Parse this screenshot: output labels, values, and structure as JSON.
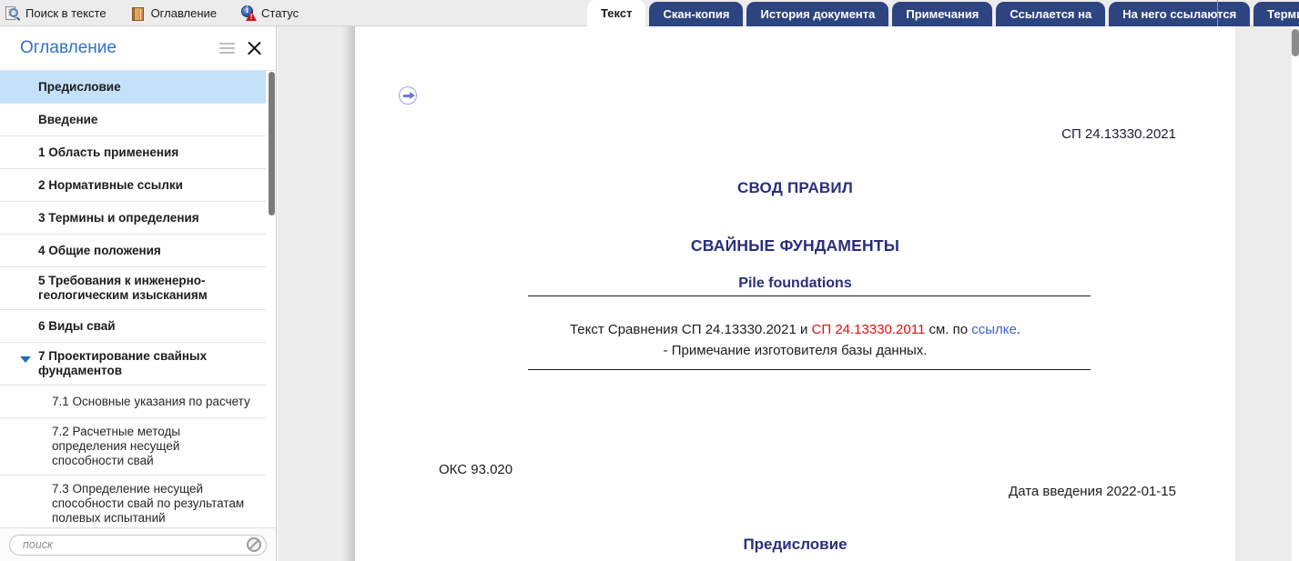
{
  "toolbar": {
    "items": [
      {
        "label": "Поиск в тексте",
        "icon": "search-document-icon"
      },
      {
        "label": "Оглавление",
        "icon": "book-icon"
      },
      {
        "label": "Статус",
        "icon": "status-info-warning-icon"
      }
    ]
  },
  "tabs": [
    {
      "label": "Текст",
      "active": true
    },
    {
      "label": "Скан-копия",
      "active": false
    },
    {
      "label": "История документа",
      "active": false
    },
    {
      "label": "Примечания",
      "active": false
    },
    {
      "label": "Ссылается на",
      "active": false
    },
    {
      "label": "На него ссылаются",
      "active": false
    },
    {
      "label": "Термины",
      "active": false
    }
  ],
  "sidebar": {
    "title": "Оглавление",
    "menu_icon": "hamburger-icon",
    "close_icon": "close-icon",
    "items": [
      {
        "label": "Предисловие",
        "level": 1,
        "selected": true,
        "expandable": false
      },
      {
        "label": "Введение",
        "level": 1,
        "selected": false,
        "expandable": false
      },
      {
        "label": "1 Область применения",
        "level": 1,
        "selected": false,
        "expandable": false
      },
      {
        "label": "2 Нормативные ссылки",
        "level": 1,
        "selected": false,
        "expandable": false
      },
      {
        "label": "3 Термины и определения",
        "level": 1,
        "selected": false,
        "expandable": false
      },
      {
        "label": "4 Общие положения",
        "level": 1,
        "selected": false,
        "expandable": false
      },
      {
        "label": "5 Требования к инженерно-геологическим изысканиям",
        "level": 1,
        "selected": false,
        "expandable": false
      },
      {
        "label": "6 Виды свай",
        "level": 1,
        "selected": false,
        "expandable": false
      },
      {
        "label": "7 Проектирование свайных фундаментов",
        "level": 1,
        "selected": false,
        "expandable": true
      },
      {
        "label": "7.1 Основные указания по расчету",
        "level": 2,
        "selected": false,
        "expandable": false
      },
      {
        "label": "7.2 Расчетные методы определения несущей способности свай",
        "level": 2,
        "selected": false,
        "expandable": false
      },
      {
        "label": "7.3 Определение несущей способности свай по результатам полевых испытаний",
        "level": 2,
        "selected": false,
        "expandable": false
      }
    ],
    "search": {
      "placeholder": "поиск",
      "value": "",
      "clear_icon": "clear-circle-slash-icon"
    }
  },
  "document": {
    "nav_arrow_icon": "arrow-right-circle-icon",
    "code": "СП 24.13330.2021",
    "heading_kind": "СВОД ПРАВИЛ",
    "title_ru": "СВАЙНЫЕ ФУНДАМЕНТЫ",
    "title_en": "Pile foundations",
    "note": {
      "line1_prefix": "Текст Сравнения СП 24.13330.2021 и ",
      "line1_red": "СП 24.13330.2011",
      "line1_mid": " см. по ",
      "line1_link": "ссылке",
      "line1_suffix": ".",
      "line2": "- Примечание изготовителя базы данных."
    },
    "oks": "ОКС 93.020",
    "intro_date": "Дата введения 2022-01-15",
    "section_heading": "Предисловие"
  },
  "colors": {
    "tab_active_bg": "#ffffff",
    "tab_inactive_bg": "#2e4480",
    "sidebar_title": "#2f72c4",
    "selected_row": "#c5e1fa",
    "doc_heading": "#2b2e7a",
    "red_text": "#e01010",
    "link_text": "#3b63c8"
  }
}
